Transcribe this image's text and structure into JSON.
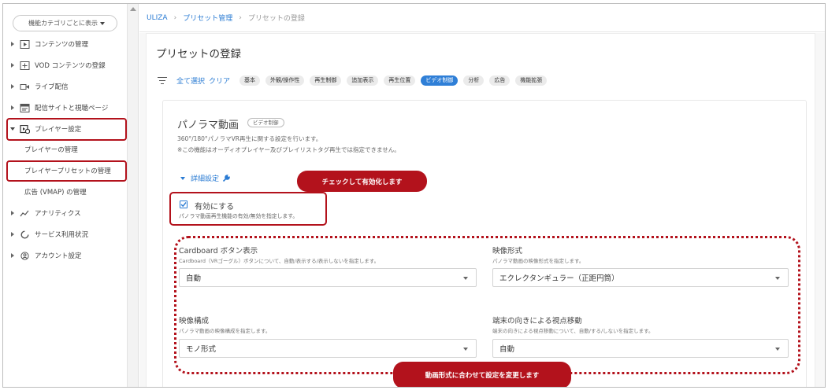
{
  "sidebar": {
    "category_select": "機能カテゴリごとに表示",
    "items": [
      {
        "label": "コンテンツの管理",
        "icon": "play-square-icon"
      },
      {
        "label": "VOD コンテンツの登録",
        "icon": "plus-square-icon"
      },
      {
        "label": "ライブ配信",
        "icon": "video-camera-icon"
      },
      {
        "label": "配信サイトと視聴ページ",
        "icon": "browser-window-icon"
      },
      {
        "label": "プレイヤー設定",
        "icon": "player-settings-icon"
      }
    ],
    "subitems": [
      "プレイヤーの管理",
      "プレイヤープリセットの管理",
      "広告 (VMAP) の管理"
    ],
    "items_after": [
      {
        "label": "アナリティクス",
        "icon": "analytics-icon"
      },
      {
        "label": "サービス利用状況",
        "icon": "usage-circle-icon"
      },
      {
        "label": "アカウント設定",
        "icon": "account-icon"
      }
    ]
  },
  "breadcrumb": {
    "root": "ULIZA",
    "parent": "プリセット管理",
    "current": "プリセットの登録"
  },
  "page": {
    "title": "プリセットの登録",
    "select_all": "全て選択",
    "clear": "クリア",
    "chips": [
      "基本",
      "外観/操作性",
      "再生制御",
      "追加表示",
      "再生位置",
      "ビデオ制御",
      "分析",
      "広告",
      "機能拡張"
    ],
    "active_chip": "ビデオ制御"
  },
  "section": {
    "title": "パノラマ動画",
    "badge": "ビデオ制御",
    "desc1": "360°/180°パノラマVR再生に関する設定を行います。",
    "desc2": "※この機能はオーディオプレイヤー及びプレイリストタグ再生では指定できません。",
    "detail_link": "詳細設定",
    "enable_label": "有効にする",
    "enable_help": "パノラマ動画再生機能の有効/無効を指定します。",
    "enable_checked": true,
    "fields": {
      "cardboard": {
        "label": "Cardboard ボタン表示",
        "help": "Cardboard（VRゴーグル）ボタンについて、自動/表示する/表示しないを指定します。",
        "value": "自動"
      },
      "format": {
        "label": "映像形式",
        "help": "パノラマ動画の映像形式を指定します。",
        "value": "エクレクタンギュラー（正距円筒）"
      },
      "layout": {
        "label": "映像構成",
        "help": "パノラマ動画の映像構成を指定します。",
        "value": "モノ形式"
      },
      "orientation": {
        "label": "端末の向きによる視点移動",
        "help": "端末の向きによる視点移動について、自動/する/しないを指定します。",
        "value": "自動"
      }
    }
  },
  "annotations": {
    "enable_callout": "チェックして有効化します",
    "format_callout": "動画形式に合わせて設定を変更します"
  },
  "colors": {
    "accent": "#2a7bd3",
    "annotation": "#b3121c",
    "chip_active": "#2f7fd7"
  }
}
